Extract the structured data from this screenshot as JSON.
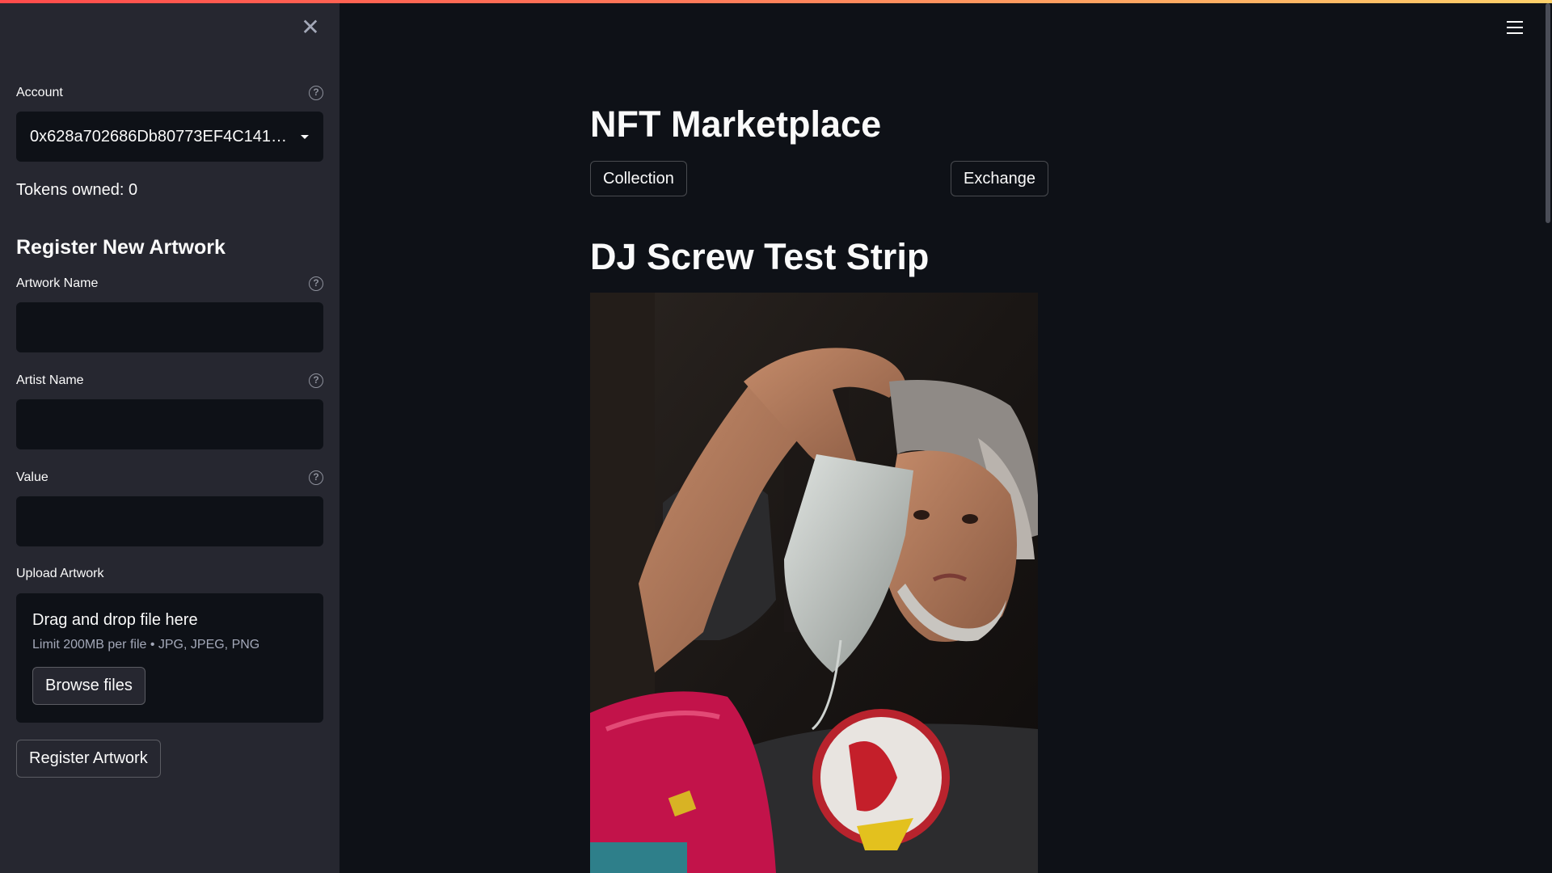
{
  "sidebar": {
    "close_icon": "close-icon",
    "account": {
      "label": "Account",
      "value": "0x628a702686Db80773EF4C141…",
      "help_icon": "question-circle-icon"
    },
    "tokens_owned": "Tokens owned: 0",
    "register_heading": "Register New Artwork",
    "fields": {
      "artwork_name": {
        "label": "Artwork Name",
        "value": ""
      },
      "artist_name": {
        "label": "Artist Name",
        "value": ""
      },
      "value": {
        "label": "Value",
        "value": ""
      }
    },
    "upload": {
      "label": "Upload Artwork",
      "title": "Drag and drop file here",
      "limit": "Limit 200MB per file • JPG, JPEG, PNG",
      "browse_label": "Browse files"
    },
    "register_button": "Register Artwork"
  },
  "main": {
    "menu_icon": "hamburger-menu-icon",
    "title": "NFT Marketplace",
    "tabs": [
      "Collection",
      "Exchange"
    ],
    "artwork": {
      "title": "DJ Screw Test Strip"
    }
  },
  "colors": {
    "background": "#0e1117",
    "sidebar": "#262730",
    "text": "#fafafa",
    "accent_gradient_start": "#ff4b4b",
    "accent_gradient_end": "#ffd16a"
  }
}
